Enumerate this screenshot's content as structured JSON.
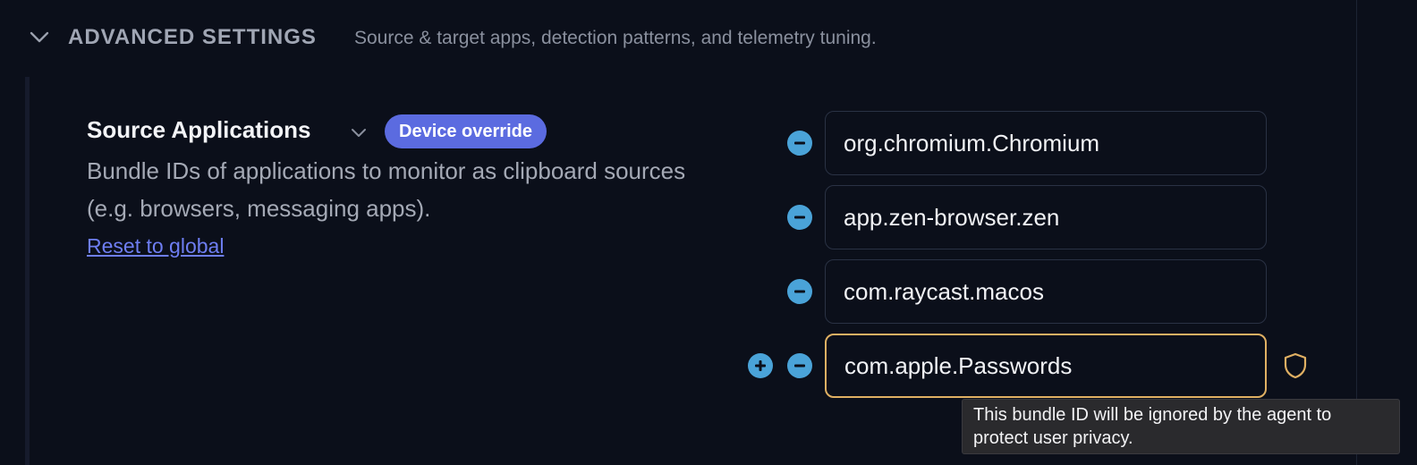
{
  "section": {
    "title": "ADVANCED SETTINGS",
    "description": "Source & target apps, detection patterns, and telemetry tuning.",
    "collapse_icon": "chevron-down-icon"
  },
  "setting": {
    "title": "Source Applications",
    "expand_icon": "chevron-down-icon",
    "badge": "Device override",
    "description": "Bundle IDs of applications to monitor as clipboard sources (e.g. browsers, messaging apps).",
    "reset_link": "Reset to global",
    "items": [
      {
        "value": "org.chromium.Chromium"
      },
      {
        "value": "app.zen-browser.zen"
      },
      {
        "value": "com.raycast.macos"
      },
      {
        "value": "com.apple.Passwords",
        "warning": true
      }
    ],
    "add_icon": "plus-circle-icon",
    "remove_icon": "minus-circle-icon",
    "warning_icon": "shield-icon",
    "warning_tooltip": "This bundle ID will be ignored by the agent to protect user privacy."
  },
  "colors": {
    "background": "#0b0f1a",
    "accent_badge": "#5b6be0",
    "link": "#6e7ef2",
    "control_icon": "#4aa3d8",
    "warning": "#e0b063"
  }
}
